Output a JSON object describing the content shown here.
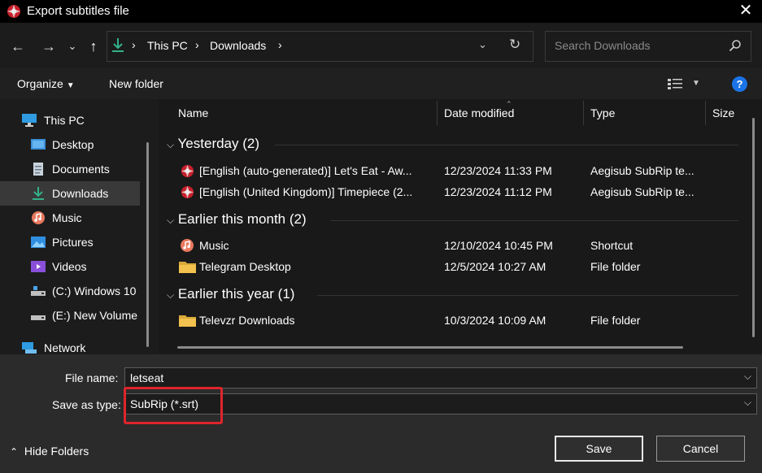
{
  "window": {
    "title": "Export subtitles file"
  },
  "nav": {
    "breadcrumb": [
      "This PC",
      "Downloads"
    ],
    "search_placeholder": "Search Downloads"
  },
  "toolbar": {
    "organize": "Organize",
    "new_folder": "New folder"
  },
  "sidebar": {
    "items": [
      {
        "label": "This PC",
        "icon": "monitor-icon"
      },
      {
        "label": "Desktop",
        "icon": "desktop-icon"
      },
      {
        "label": "Documents",
        "icon": "document-icon"
      },
      {
        "label": "Downloads",
        "icon": "download-icon",
        "selected": true
      },
      {
        "label": "Music",
        "icon": "music-icon"
      },
      {
        "label": "Pictures",
        "icon": "pictures-icon"
      },
      {
        "label": "Videos",
        "icon": "videos-icon"
      },
      {
        "label": "(C:) Windows 10",
        "icon": "drive-icon"
      },
      {
        "label": "(E:) New Volume",
        "icon": "drive-icon"
      },
      {
        "label": "Network",
        "icon": "network-icon"
      }
    ]
  },
  "columns": {
    "name": "Name",
    "date": "Date modified",
    "type": "Type",
    "size": "Size"
  },
  "groups": [
    {
      "title": "Yesterday (2)",
      "files": [
        {
          "name": "[English (auto-generated)] Let's Eat - Aw...",
          "date": "12/23/2024 11:33 PM",
          "type": "Aegisub SubRip te...",
          "icon": "aegisub-icon"
        },
        {
          "name": "[English (United Kingdom)] Timepiece (2...",
          "date": "12/23/2024 11:12 PM",
          "type": "Aegisub SubRip te...",
          "icon": "aegisub-icon"
        }
      ]
    },
    {
      "title": "Earlier this month (2)",
      "files": [
        {
          "name": "Music",
          "date": "12/10/2024 10:45 PM",
          "type": "Shortcut",
          "icon": "music-icon"
        },
        {
          "name": "Telegram Desktop",
          "date": "12/5/2024 10:27 AM",
          "type": "File folder",
          "icon": "folder-icon"
        }
      ]
    },
    {
      "title": "Earlier this year (1)",
      "files": [
        {
          "name": "Televzr Downloads",
          "date": "10/3/2024 10:09 AM",
          "type": "File folder",
          "icon": "folder-icon"
        }
      ]
    }
  ],
  "form": {
    "file_name_label": "File name:",
    "file_name_value": "letseat",
    "save_type_label": "Save as type:",
    "save_type_value": "SubRip (*.srt)"
  },
  "footer": {
    "hide_folders": "Hide Folders",
    "save": "Save",
    "cancel": "Cancel"
  },
  "colors": {
    "highlight": "#e0242b",
    "accent_help": "#1a73e8",
    "folder": "#f2c14e",
    "download": "#33b18a"
  }
}
